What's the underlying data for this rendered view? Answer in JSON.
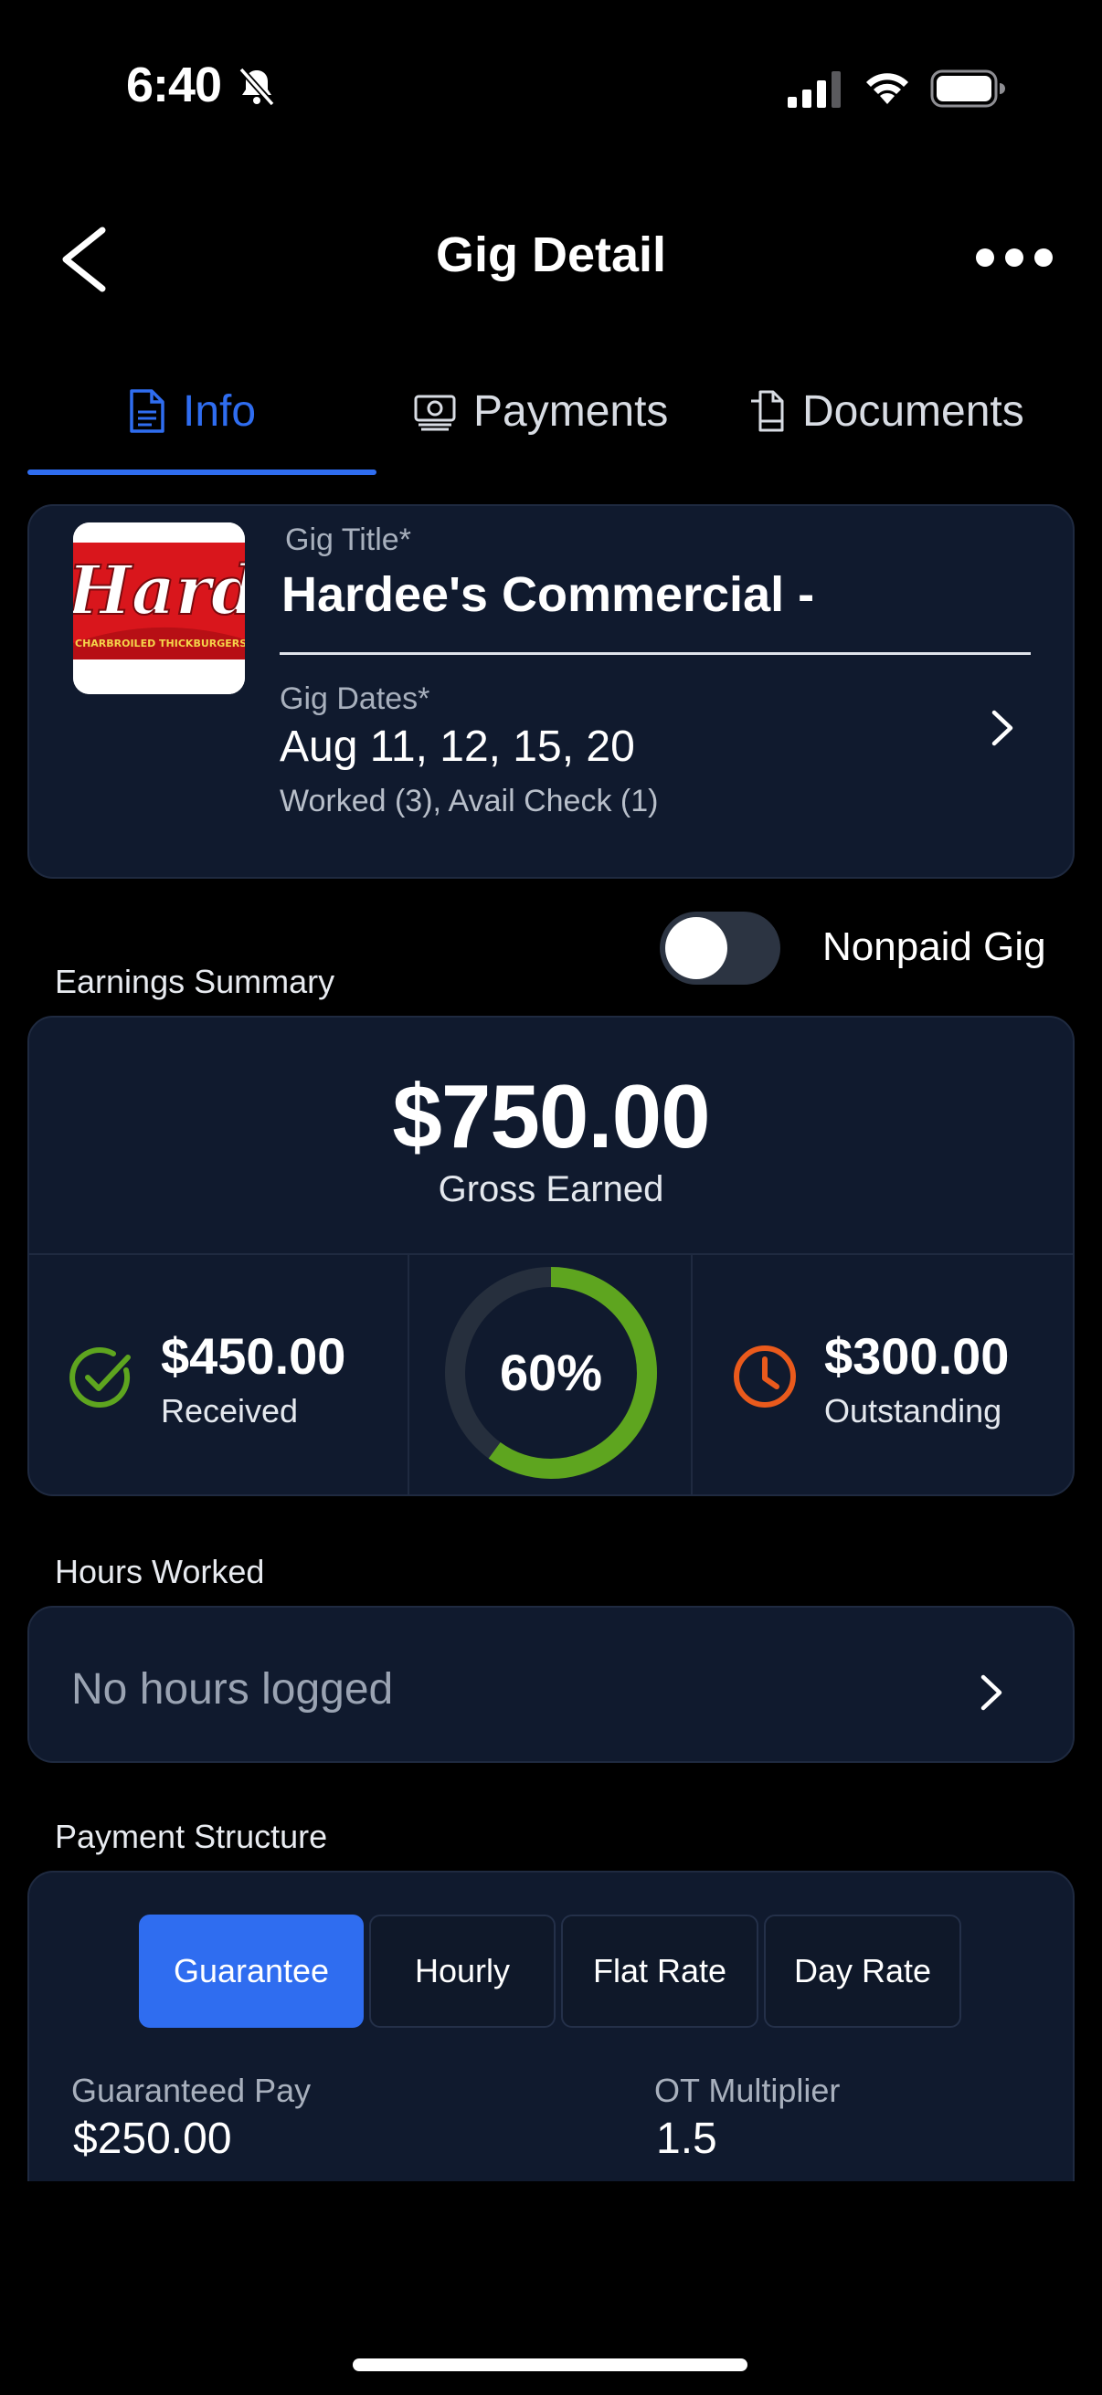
{
  "status_bar": {
    "time": "6:40"
  },
  "header": {
    "title": "Gig Detail"
  },
  "tabs": [
    {
      "label": "Info",
      "active": true
    },
    {
      "label": "Payments",
      "active": false
    },
    {
      "label": "Documents",
      "active": false
    }
  ],
  "gig": {
    "logo_text": "Hardee",
    "logo_tagline": "CHARBROILED THICKBURGERS",
    "title_label": "Gig Title*",
    "title": "Hardee's Commercial -",
    "dates_label": "Gig Dates*",
    "dates": "Aug 11, 12, 15, 20",
    "dates_summary": "Worked (3), Avail Check (1)"
  },
  "nonpaid": {
    "label": "Nonpaid Gig",
    "enabled": false
  },
  "earnings": {
    "section_label": "Earnings Summary",
    "gross_value": "$750.00",
    "gross_label": "Gross Earned",
    "received_value": "$450.00",
    "received_label": "Received",
    "percent_text": "60%",
    "percent": 60,
    "outstanding_value": "$300.00",
    "outstanding_label": "Outstanding",
    "colors": {
      "received": "#5ea51f",
      "outstanding": "#ea5a1c",
      "ring_track": "#262f3d"
    }
  },
  "hours": {
    "section_label": "Hours Worked",
    "empty_text": "No hours logged"
  },
  "payment_structure": {
    "section_label": "Payment Structure",
    "options": [
      "Guarantee",
      "Hourly",
      "Flat Rate",
      "Day Rate"
    ],
    "selected": "Guarantee",
    "guaranteed_pay_label": "Guaranteed Pay",
    "guaranteed_pay": "$250.00",
    "ot_label": "OT Multiplier",
    "ot_value": "1.5"
  },
  "colors": {
    "accent": "#2f6df0",
    "card": "#101a2e",
    "background": "#000000"
  }
}
